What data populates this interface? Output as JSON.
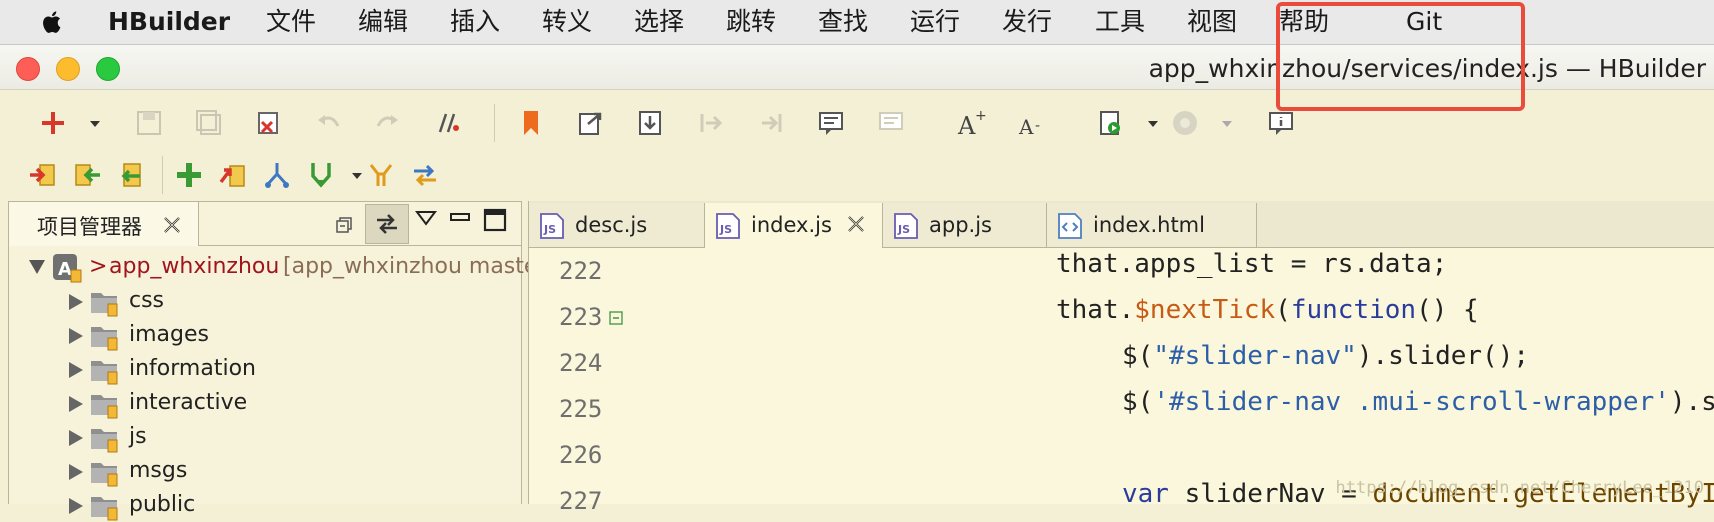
{
  "menubar": {
    "app": "HBuilder",
    "items": [
      "文件",
      "编辑",
      "插入",
      "转义",
      "选择",
      "跳转",
      "查找",
      "运行",
      "发行",
      "工具",
      "视图",
      "帮助",
      "Git"
    ]
  },
  "window": {
    "title": "app_whxinzhou/services/index.js — HBuilder"
  },
  "toolbar1": [
    "new-icon",
    "new-dropdown-icon",
    "save-icon",
    "save-all-icon",
    "delete-icon",
    "undo-icon",
    "redo-icon",
    "format-icon",
    "bookmark-icon",
    "export-icon",
    "import-icon",
    "step-in-icon",
    "step-out-icon",
    "comment-icon",
    "uncomment-icon",
    "font-increase-icon",
    "font-decrease-icon",
    "run-icon",
    "run-dropdown-icon",
    "browser-icon",
    "browser-dropdown-icon",
    "info-icon"
  ],
  "toolbar2": [
    "git-pull-icon",
    "git-push-icon",
    "git-fetch-icon",
    "git-add-icon",
    "git-commit-icon",
    "git-branch-icon",
    "git-merge-icon",
    "git-merge-dropdown-icon",
    "git-reset-icon",
    "git-sync-icon"
  ],
  "explorer": {
    "tab_label": "项目管理器",
    "root_name": "app_whxinzhou",
    "root_branch": "[app_whxinzhou master",
    "root_prefix": ">",
    "folders": [
      "css",
      "images",
      "information",
      "interactive",
      "js",
      "msgs",
      "public"
    ]
  },
  "editor": {
    "tabs": [
      {
        "label": "desc.js",
        "active": false
      },
      {
        "label": "index.js",
        "active": true
      },
      {
        "label": "app.js",
        "active": false
      },
      {
        "label": "index.html",
        "active": false
      }
    ],
    "line_numbers": [
      "222",
      "223",
      "224",
      "225",
      "226",
      "227"
    ],
    "code": {
      "l1_a": "that.apps_list = rs.data;",
      "l2_a": "that.",
      "l2_fn": "$nextTick",
      "l2_b": "(",
      "l2_kw": "function",
      "l2_c": "() {",
      "l3_a": "$(",
      "l3_str": "\"#slider-nav\"",
      "l3_b": ").slider();",
      "l4_a": "$(",
      "l4_str": "'#slider-nav .mui-scroll-wrapper'",
      "l4_b": ").s",
      "l6_kw": "var",
      "l6_a": " sliderNav = ",
      "l6_call": "document.getElementByI"
    },
    "watermark": "https://blog.csdn.net/CherryLee_1210"
  },
  "colors": {
    "highlight": "#ea4b3a",
    "background": "#f4f0d6",
    "editor_bg": "#fbf7dc"
  }
}
